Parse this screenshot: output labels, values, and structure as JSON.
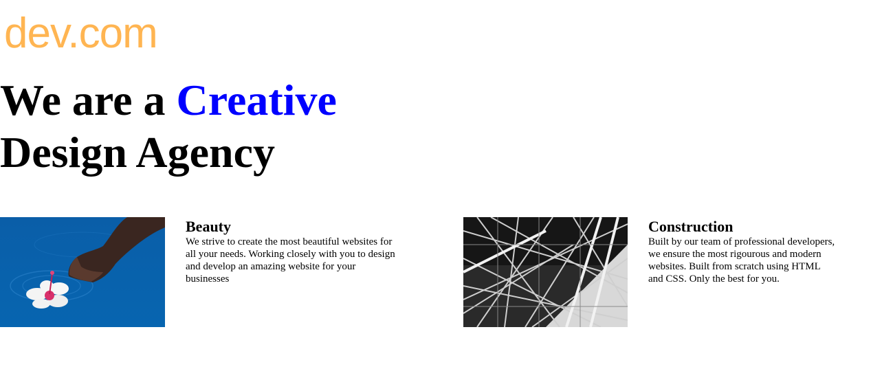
{
  "logo": {
    "text": "dev.com",
    "color": "#ffb552"
  },
  "hero": {
    "line1_prefix": "We are a ",
    "line1_accent": "Creative",
    "line2": "Design Agency",
    "accent_color": "#0000ff"
  },
  "cards": [
    {
      "title": "Beauty",
      "text": "We strive to create the most beautiful websites for all your needs. Working closely with you to design and develop an amazing website for your businesses",
      "image_icon": "hand-flower-water-photo"
    },
    {
      "title": "Construction",
      "text": "Built by our team of professional developers, we ensure the most rigourous and modern websites. Built from scratch using HTML and CSS. Only the best for you.",
      "image_icon": "steel-structure-photo"
    }
  ]
}
